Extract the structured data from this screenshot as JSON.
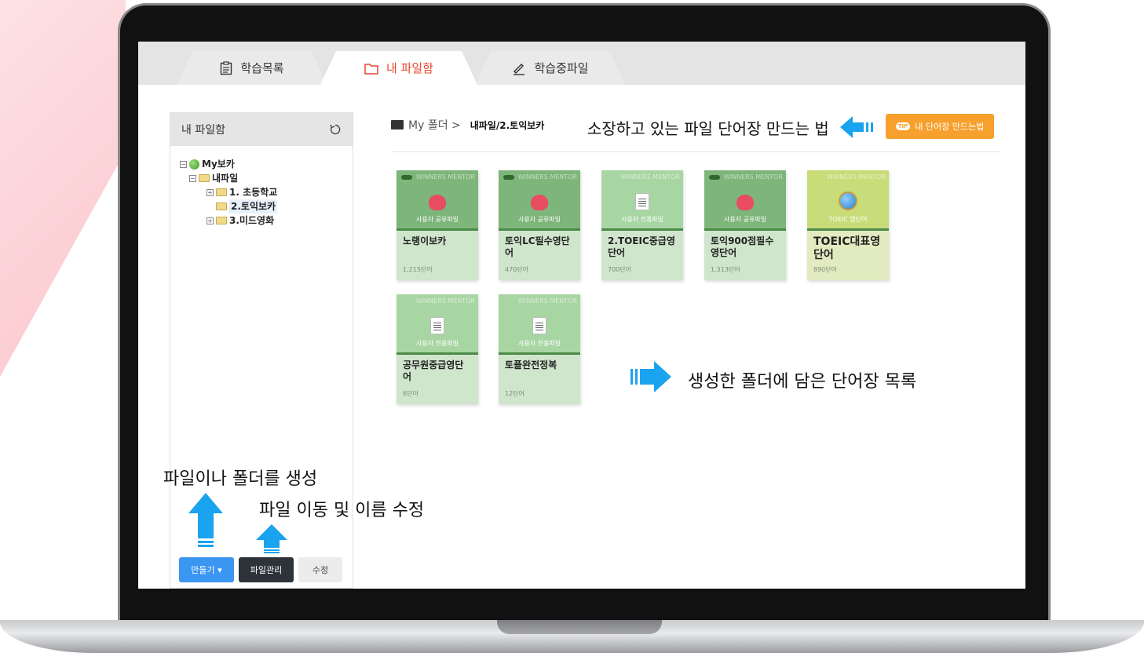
{
  "tabs": [
    {
      "label": "학습목록",
      "icon": "clipboard-icon"
    },
    {
      "label": "내 파일함",
      "icon": "folder-icon"
    },
    {
      "label": "학습중파일",
      "icon": "pencil-icon"
    }
  ],
  "sidebar": {
    "title": "내 파일함",
    "tree": {
      "root": "My보카",
      "child": "내파일",
      "items": [
        "1. 초등학교",
        "2.토익보카",
        "3.미드영화"
      ]
    },
    "buttons": {
      "make": "만들기 ▾",
      "manage": "파일관리",
      "edit": "수정"
    }
  },
  "breadcrumb": {
    "root": "My 폴더 >",
    "current": "내파일/2.토익보카"
  },
  "tip_button": {
    "badge": "TIP",
    "label": "내 단어장 만드는법"
  },
  "cards": [
    {
      "sub": "사용자 공유파일",
      "title": "노랭이보카",
      "count": "1,215단어",
      "type": "share",
      "watermark": "WINNERS MENTOR"
    },
    {
      "sub": "사용자 공유파일",
      "title": "토익LC필수영단어",
      "count": "470단어",
      "type": "share",
      "watermark": "WINNERS MENTOR"
    },
    {
      "sub": "사용자 전용파일",
      "title": "2.TOEIC중급영단어",
      "count": "700단어",
      "type": "doc",
      "watermark": "WINNERS MENTOR"
    },
    {
      "sub": "사용자 공유파일",
      "title": "토익900점필수영단어",
      "count": "1,313단어",
      "type": "share",
      "watermark": "WINNERS MENTOR"
    },
    {
      "sub": "TOEIC 영단어",
      "title": "TOEIC대표영단어",
      "count": "890단어",
      "type": "toeic",
      "watermark": "WINNERS MENTOR"
    },
    {
      "sub": "사용자 전용파일",
      "title": "공무원중급영단어",
      "count": "6단어",
      "type": "doc",
      "watermark": "WINNERS MENTOR"
    },
    {
      "sub": "사용자 전용파일",
      "title": "토플완전정복",
      "count": "12단어",
      "type": "doc",
      "watermark": "WINNERS MENTOR"
    }
  ],
  "annotations": {
    "top": "소장하고 있는 파일 단어장 만드는 법",
    "middle": "생성한 폴더에 담은 단어장 목록",
    "create": "파일이나 폴더를 생성",
    "manage": "파일 이동 및 이름 수정"
  },
  "colors": {
    "accent_red": "#e8452d",
    "arrow_blue": "#1aa3ef",
    "tip_orange": "#f7a02e",
    "card_green": "#7db57a"
  }
}
